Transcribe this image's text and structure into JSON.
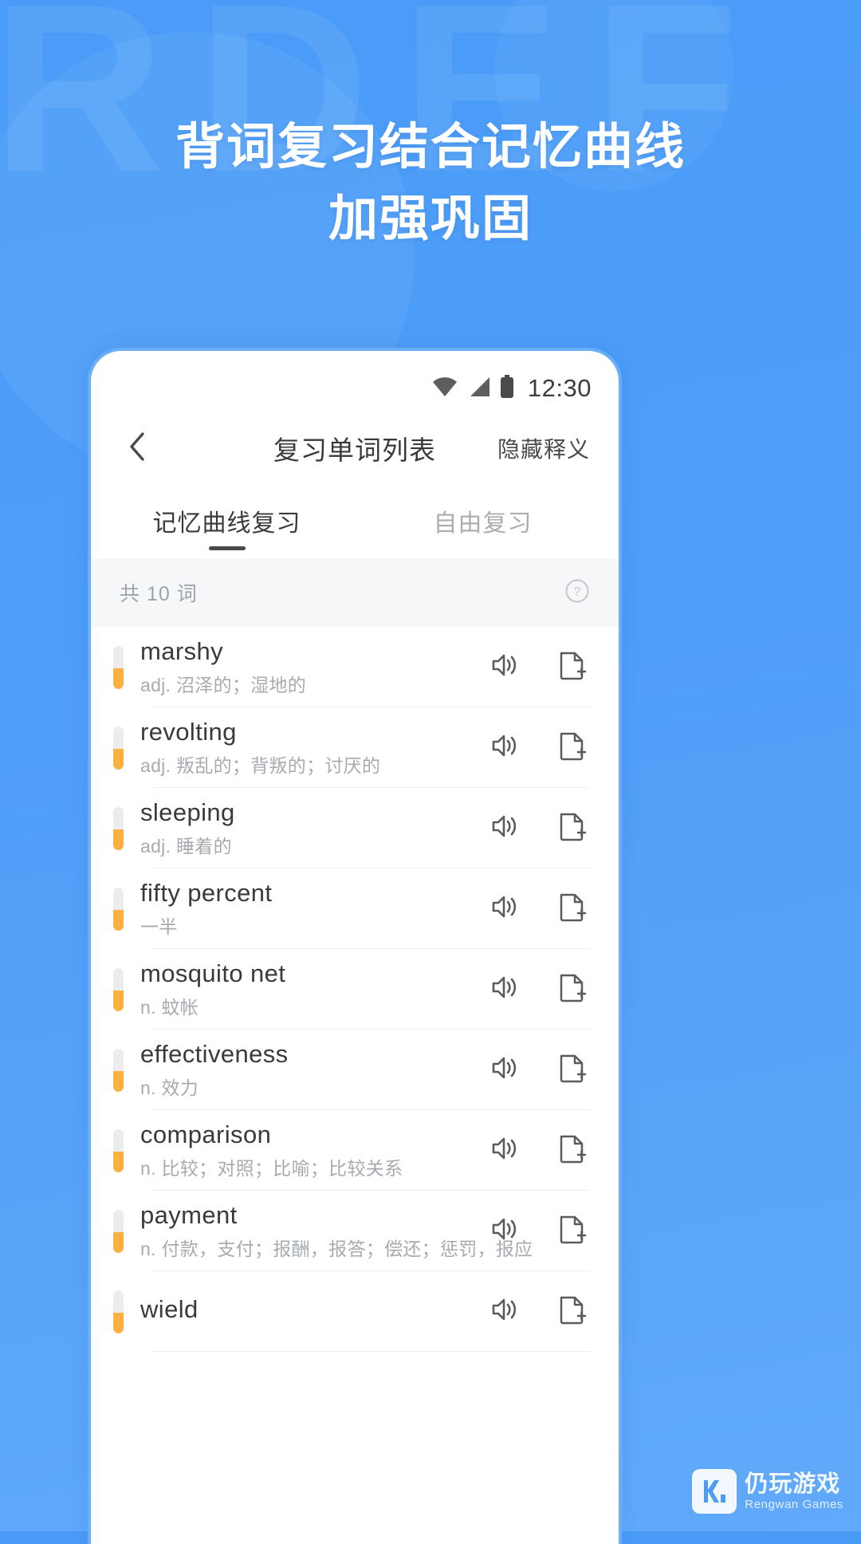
{
  "promo": {
    "headline_line1": "背词复习结合记忆曲线",
    "headline_line2": "加强巩固",
    "ghost_text": "RDEF",
    "background_color": "#4a9bf7",
    "headline_color": "#ffffff"
  },
  "statusbar": {
    "wifi_icon": "wifi-icon",
    "signal_icon": "signal-icon",
    "battery_icon": "battery-icon",
    "time": "12:30"
  },
  "navbar": {
    "back_icon": "chevron-left-icon",
    "title": "复习单词列表",
    "action_label": "隐藏释义"
  },
  "tabs": [
    {
      "label": "记忆曲线复习",
      "active": true
    },
    {
      "label": "自由复习",
      "active": false
    }
  ],
  "summary": {
    "count_text": "共 10 词",
    "help_icon": "question-circle-icon"
  },
  "list": {
    "speaker_icon": "speaker-icon",
    "add_note_icon": "document-plus-icon",
    "accent_color": "#fbb040",
    "track_color": "#ececec",
    "items": [
      {
        "term": "marshy",
        "definition": "adj. 沼泽的；湿地的",
        "progress": 48
      },
      {
        "term": "revolting",
        "definition": "adj. 叛乱的；背叛的；讨厌的",
        "progress": 48
      },
      {
        "term": "sleeping",
        "definition": "adj. 睡着的",
        "progress": 48
      },
      {
        "term": "fifty percent",
        "definition": "一半",
        "progress": 48
      },
      {
        "term": "mosquito net",
        "definition": "n. 蚊帐",
        "progress": 48
      },
      {
        "term": "effectiveness",
        "definition": "n. 效力",
        "progress": 48
      },
      {
        "term": "comparison",
        "definition": "n. 比较；对照；比喻；比较关系",
        "progress": 48
      },
      {
        "term": "payment",
        "definition": "n. 付款，支付；报酬，报答；偿还；惩罚，报应",
        "progress": 48
      },
      {
        "term": "wield",
        "definition": "",
        "progress": 48
      }
    ]
  },
  "watermark": {
    "name_cn": "仍玩游戏",
    "name_en": "Rengwan Games",
    "logo_icon": "rengwan-logo-icon"
  }
}
